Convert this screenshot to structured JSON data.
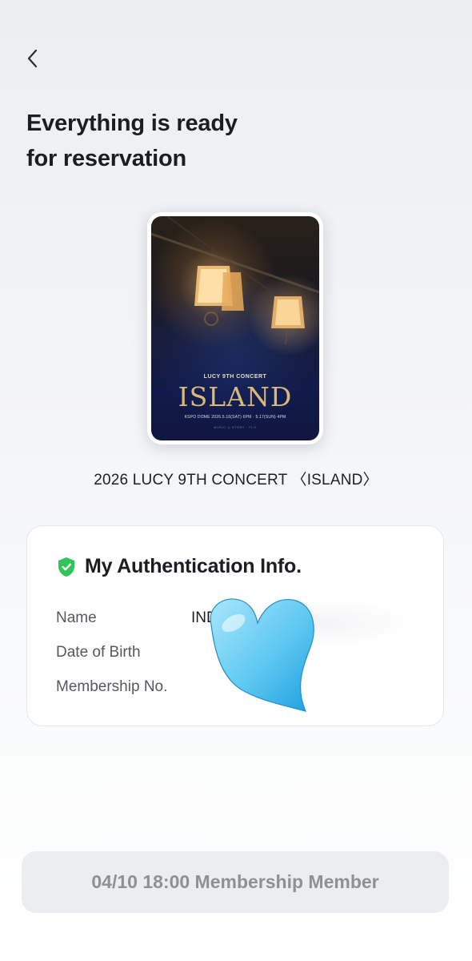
{
  "header": {
    "back_icon": "chevron-left-icon",
    "title_line1": "Everything is ready",
    "title_line2": "for reservation"
  },
  "poster": {
    "subtitle": "LUCY 9TH CONCERT",
    "title": "ISLAND",
    "venue_dates": "KSPO DOME   2026.5.16(SAT) 6PM · 5.17(SUN) 4PM",
    "footer": "MUSIC ◎ STORY · FLO"
  },
  "concert": {
    "name": "2026 LUCY 9TH CONCERT 〈ISLAND〉"
  },
  "auth_card": {
    "title": "My Authentication Info.",
    "icon": "shield-check-icon",
    "accent_color": "#2fc55b",
    "fields": [
      {
        "label": "Name",
        "value": "INDAH"
      },
      {
        "label": "Date of Birth",
        "value": ""
      },
      {
        "label": "Membership No.",
        "value": ""
      }
    ],
    "redaction": "blue-heart-emoji"
  },
  "footer_button": {
    "label": "04/10 18:00 Membership Member"
  }
}
